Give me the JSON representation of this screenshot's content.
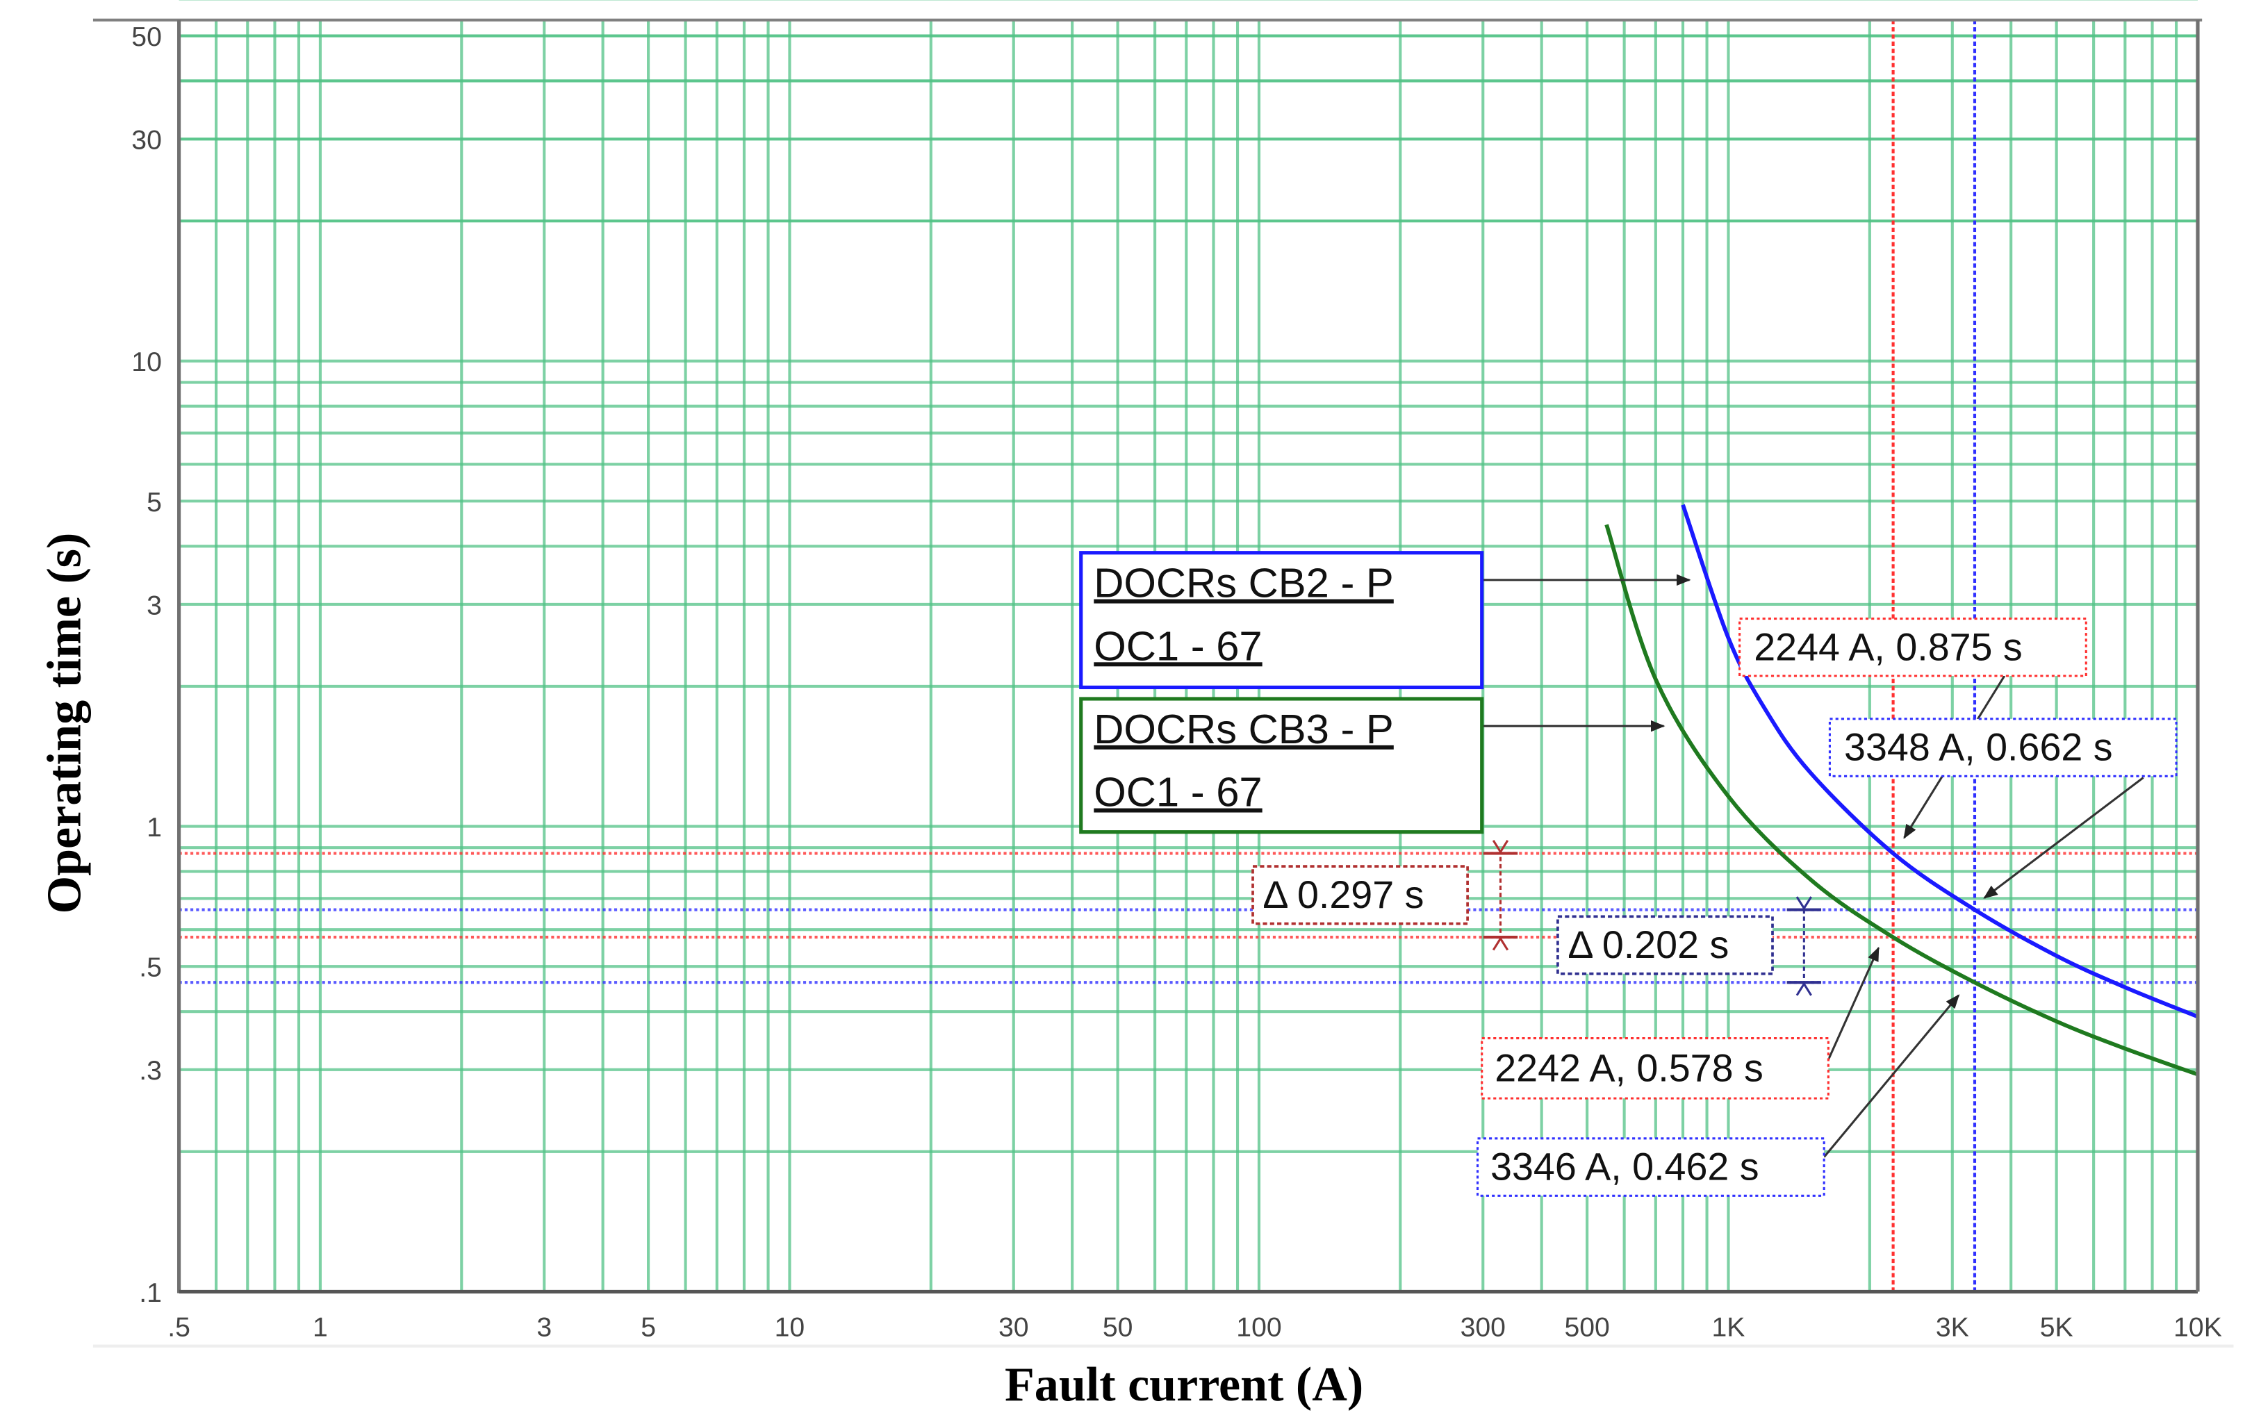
{
  "chart_data": {
    "type": "line",
    "xscale": "log",
    "yscale": "log",
    "xlabel": "Fault current (A)",
    "ylabel": "Operating time (s)",
    "xlim": [
      0.5,
      10000
    ],
    "ylim": [
      0.1,
      50
    ],
    "grid": true,
    "x_ticks": [
      {
        "v": 0.5,
        "label": ".5"
      },
      {
        "v": 1,
        "label": "1"
      },
      {
        "v": 3,
        "label": "3"
      },
      {
        "v": 5,
        "label": "5"
      },
      {
        "v": 10,
        "label": "10"
      },
      {
        "v": 30,
        "label": "30"
      },
      {
        "v": 50,
        "label": "50"
      },
      {
        "v": 100,
        "label": "100"
      },
      {
        "v": 300,
        "label": "300"
      },
      {
        "v": 500,
        "label": "500"
      },
      {
        "v": 1000,
        "label": "1K"
      },
      {
        "v": 3000,
        "label": "3K"
      },
      {
        "v": 5000,
        "label": "5K"
      },
      {
        "v": 10000,
        "label": "10K"
      }
    ],
    "y_ticks": [
      {
        "v": 50,
        "label": "50"
      },
      {
        "v": 30,
        "label": "30"
      },
      {
        "v": 10,
        "label": "10"
      },
      {
        "v": 5,
        "label": "5"
      },
      {
        "v": 3,
        "label": "3"
      },
      {
        "v": 1,
        "label": "1"
      },
      {
        "v": 0.5,
        "label": ".5"
      },
      {
        "v": 0.3,
        "label": ".3"
      },
      {
        "v": 0.1,
        "label": ".1"
      }
    ],
    "series": [
      {
        "name": "DOCRs CB2 - P OC1 - 67",
        "legend_lines": [
          "DOCRs CB2 - P",
          "OC1 - 67"
        ],
        "color": "#1a1aff",
        "x": [
          800,
          1000,
          1200,
          1500,
          2244,
          3348,
          5000,
          7000,
          10000
        ],
        "y": [
          4.91,
          2.54,
          1.78,
          1.3,
          0.875,
          0.662,
          0.527,
          0.451,
          0.39
        ]
      },
      {
        "name": "DOCRs CB3 - P OC1 - 67",
        "legend_lines": [
          "DOCRs CB3 - P",
          "OC1 - 67"
        ],
        "color": "#1f7a1f",
        "x": [
          550,
          700,
          1000,
          1500,
          2242,
          3346,
          5000,
          7000,
          10000
        ],
        "y": [
          4.45,
          2.07,
          1.16,
          0.767,
          0.578,
          0.462,
          0.381,
          0.333,
          0.293
        ]
      }
    ],
    "reference_lines": {
      "red": {
        "color": "#ff3030",
        "current": 2244,
        "times": [
          0.875,
          0.578
        ]
      },
      "blue": {
        "color": "#3030ff",
        "current": 3348,
        "times": [
          0.662,
          0.462
        ]
      }
    },
    "annotations": [
      {
        "text": "2244 A, 0.875 s",
        "color": "#ff3030",
        "point": [
          2244,
          0.875
        ]
      },
      {
        "text": "3348 A, 0.662 s",
        "color": "#3030ff",
        "point": [
          3348,
          0.662
        ]
      },
      {
        "text": "2242 A, 0.578 s",
        "color": "#ff3030",
        "point": [
          2242,
          0.578
        ]
      },
      {
        "text": "3346 A, 0.462 s",
        "color": "#3030ff",
        "point": [
          3346,
          0.462
        ]
      },
      {
        "text": "Δ 0.297 s",
        "color": "#b03030",
        "span": [
          0.578,
          0.875
        ]
      },
      {
        "text": "Δ 0.202 s",
        "color": "#303090",
        "span": [
          0.462,
          0.662
        ]
      }
    ]
  }
}
